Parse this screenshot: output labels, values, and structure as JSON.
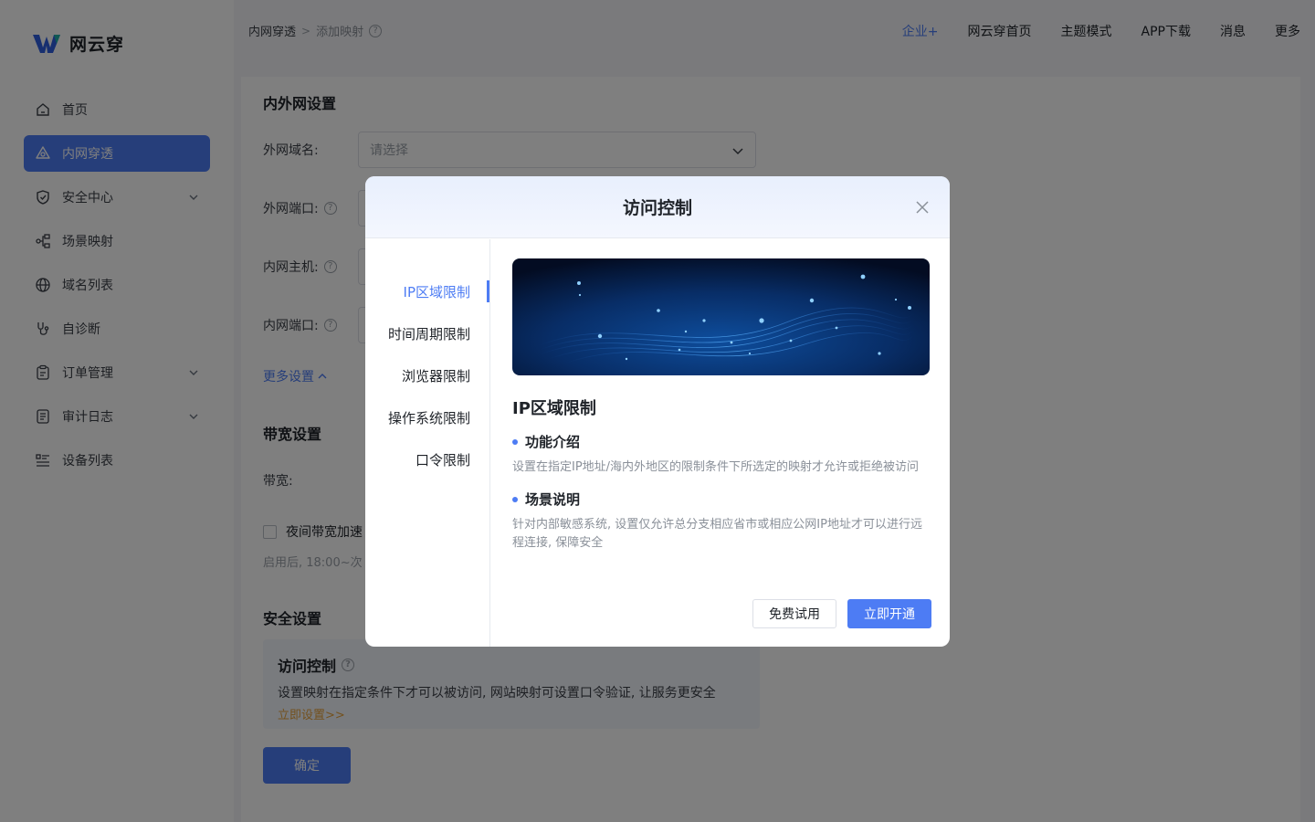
{
  "app": {
    "name": "网云穿"
  },
  "breadcrumb": {
    "root": "内网穿透",
    "separator": ">",
    "current": "添加映射",
    "help_icon": "?"
  },
  "topnav": {
    "items": [
      "企业+",
      "网云穿首页",
      "主题模式",
      "APP下载",
      "消息",
      "更多"
    ]
  },
  "sidebar": {
    "items": [
      {
        "label": "首页",
        "icon": "home-icon"
      },
      {
        "label": "内网穿透",
        "icon": "tunnel-icon",
        "active": true
      },
      {
        "label": "安全中心",
        "icon": "shield-icon",
        "expandable": true
      },
      {
        "label": "场景映射",
        "icon": "flow-icon"
      },
      {
        "label": "域名列表",
        "icon": "globe-icon"
      },
      {
        "label": "自诊断",
        "icon": "stethoscope-icon"
      },
      {
        "label": "订单管理",
        "icon": "clipboard-icon",
        "expandable": true
      },
      {
        "label": "审计日志",
        "icon": "log-icon",
        "expandable": true
      },
      {
        "label": "设备列表",
        "icon": "list-icon"
      }
    ]
  },
  "form": {
    "section_network": "内外网设置",
    "external_domain_label": "外网域名:",
    "external_domain_placeholder": "请选择",
    "external_port_label": "外网端口:",
    "internal_host_label": "内网主机:",
    "internal_port_label": "内网端口:",
    "more_settings": "更多设置",
    "section_bandwidth": "带宽设置",
    "bandwidth_label": "带宽:",
    "night_boost": "夜间带宽加速",
    "night_hint": "启用后, 18:00~次",
    "section_security": "安全设置",
    "access_title": "访问控制",
    "access_desc": "设置映射在指定条件下才可以被访问, 网站映射可设置口令验证, 让服务更安全",
    "access_link": "立即设置>>",
    "confirm": "确定"
  },
  "modal": {
    "title": "访问控制",
    "tabs": [
      "IP区域限制",
      "时间周期限制",
      "浏览器限制",
      "操作系统限制",
      "口令限制"
    ],
    "active_tab": 0,
    "feature_title": "IP区域限制",
    "intro_heading": "功能介绍",
    "intro_text": "设置在指定IP地址/海内外地区的限制条件下所选定的映射才允许或拒绝被访问",
    "scene_heading": "场景说明",
    "scene_text": "针对内部敏感系统, 设置仅允许总分支相应省市或相应公网IP地址才可以进行远程连接, 保障安全",
    "trial_button": "免费试用",
    "activate_button": "立即开通"
  },
  "colors": {
    "primary": "#4d7cf4",
    "link_orange": "#e6a23c",
    "overlay": "rgba(0,0,0,0.5)"
  }
}
